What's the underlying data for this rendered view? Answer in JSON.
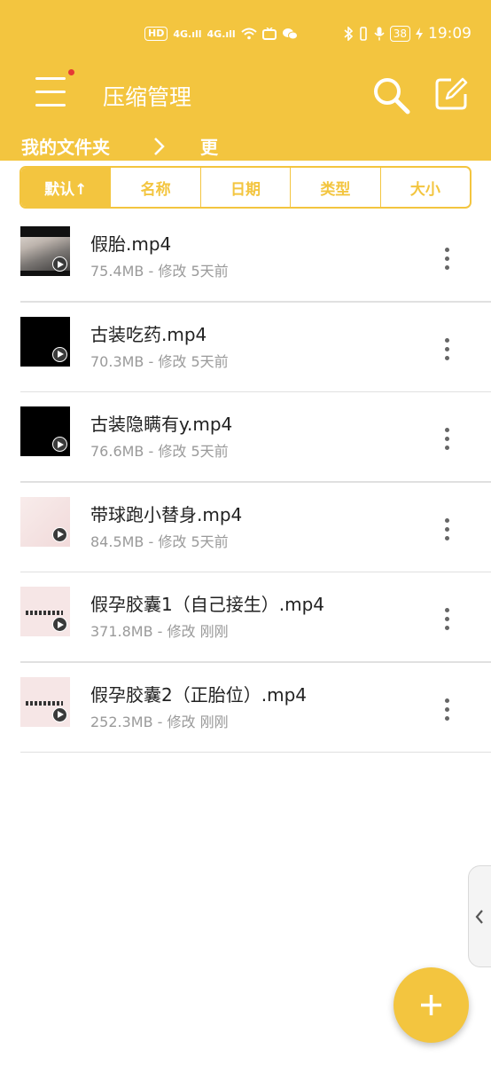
{
  "statusbar": {
    "network_badge": "HD",
    "signal_text_1": "4G.ıll",
    "signal_text_2": "4G.ıll",
    "battery": "38",
    "time": "19:09"
  },
  "header": {
    "title": "压缩管理"
  },
  "breadcrumb": {
    "folder": "我的文件夹",
    "current": "更"
  },
  "sort_tabs": [
    {
      "label": "默认↑",
      "active": true
    },
    {
      "label": "名称",
      "active": false
    },
    {
      "label": "日期",
      "active": false
    },
    {
      "label": "类型",
      "active": false
    },
    {
      "label": "大小",
      "active": false
    }
  ],
  "files": [
    {
      "name": "假胎.mp4",
      "meta": "75.4MB - 修改 5天前",
      "thumb": "photo"
    },
    {
      "name": "古装吃药.mp4",
      "meta": "70.3MB - 修改 5天前",
      "thumb": "black"
    },
    {
      "name": "古装隐瞒有y.mp4",
      "meta": "76.6MB - 修改 5天前",
      "thumb": "black"
    },
    {
      "name": "带球跑小替身.mp4",
      "meta": "84.5MB - 修改 5天前",
      "thumb": "pink"
    },
    {
      "name": "假孕胶囊1（自己接生）.mp4",
      "meta": "371.8MB - 修改 刚刚",
      "thumb": "pink-art"
    },
    {
      "name": "假孕胶囊2（正胎位）.mp4",
      "meta": "252.3MB - 修改 刚刚",
      "thumb": "pink-art"
    }
  ],
  "colors": {
    "accent": "#F3C53F",
    "text": "#222222",
    "meta": "#9a9a9a"
  }
}
